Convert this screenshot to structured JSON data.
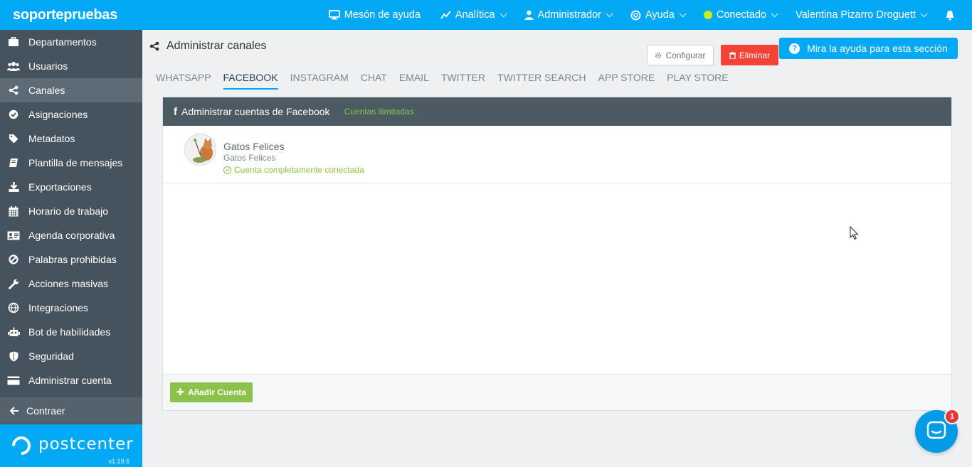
{
  "brand": "soportepruebas",
  "topnav": {
    "helpdesk": "Mesón de ayuda",
    "analytics": "Analítica",
    "admin": "Administrador",
    "help": "Ayuda",
    "status": "Conectado",
    "user": "Valentina Pizarro Droguett"
  },
  "sidebar": {
    "items": [
      {
        "label": "Departamentos",
        "icon": "briefcase-icon"
      },
      {
        "label": "Usuarios",
        "icon": "users-icon"
      },
      {
        "label": "Canales",
        "icon": "share-icon"
      },
      {
        "label": "Asignaciones",
        "icon": "check-circle-icon"
      },
      {
        "label": "Metadatos",
        "icon": "tag-icon"
      },
      {
        "label": "Plantilla de mensajes",
        "icon": "book-icon"
      },
      {
        "label": "Exportaciones",
        "icon": "download-icon"
      },
      {
        "label": "Horario de trabajo",
        "icon": "calendar-icon"
      },
      {
        "label": "Agenda corporativa",
        "icon": "address-card-icon"
      },
      {
        "label": "Palabras prohibidas",
        "icon": "ban-icon"
      },
      {
        "label": "Acciones masivas",
        "icon": "wrench-icon"
      },
      {
        "label": "Integraciones",
        "icon": "globe-icon"
      },
      {
        "label": "Bot de habilidades",
        "icon": "robot-icon"
      },
      {
        "label": "Seguridad",
        "icon": "shield-icon"
      },
      {
        "label": "Administrar cuenta",
        "icon": "credit-card-icon"
      }
    ],
    "active_index": 2,
    "collapse": "Contraer",
    "logo_text": "postcenter",
    "version": "v1.19.6"
  },
  "page": {
    "title": "Administrar canales",
    "help_button": "Mira la ayuda para esta sección"
  },
  "tabs": [
    "WHATSAPP",
    "FACEBOOK",
    "INSTAGRAM",
    "CHAT",
    "EMAIL",
    "TWITTER",
    "TWITTER SEARCH",
    "APP STORE",
    "PLAY STORE"
  ],
  "active_tab": "FACEBOOK",
  "panel": {
    "title": "Administrar cuentas de Facebook",
    "limit": "Cuentas ilimitadas",
    "account": {
      "name": "Gatos Felices",
      "subtitle": "Gatos Felices",
      "status": "Cuenta completamente conectada"
    },
    "configure": "Configurar",
    "delete": "Eliminar",
    "add": "Añadir Cuenta"
  },
  "chat": {
    "badge": "1"
  },
  "colors": {
    "primary": "#03a9f4",
    "sidebar": "#45535e",
    "success": "#8bc34a",
    "danger": "#f44336",
    "status_online": "#c6ef1b"
  }
}
